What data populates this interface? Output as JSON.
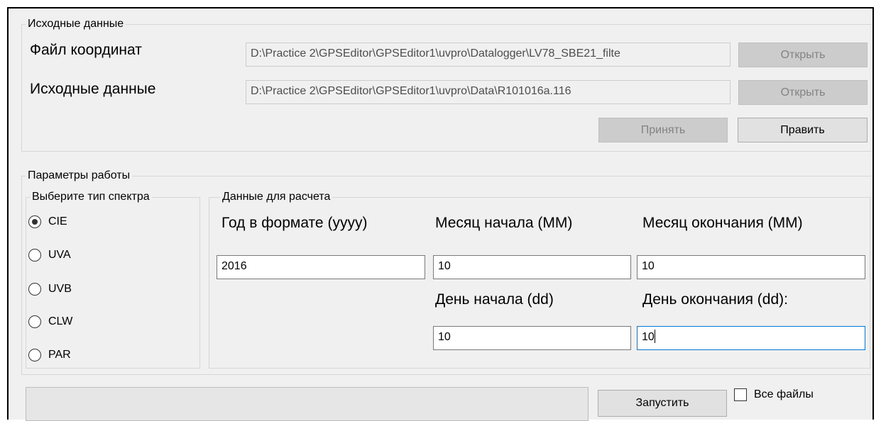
{
  "source_group": {
    "legend": "Исходные данные",
    "coords_label": "Файл координат",
    "coords_path": "D:\\Practice 2\\GPSEditor\\GPSEditor1\\uvpro\\Datalogger\\LV78_SBE21_filte",
    "coords_open_label": "Открыть",
    "data_label": "Исходные данные",
    "data_path": "D:\\Practice 2\\GPSEditor\\GPSEditor1\\uvpro\\Data\\R101016a.116",
    "data_open_label": "Открыть",
    "accept_label": "Принять",
    "edit_label": "Править"
  },
  "params_group": {
    "legend": "Параметры работы",
    "spectrum_group": {
      "legend": "Выберите тип спектра",
      "options": [
        {
          "label": "CIE",
          "checked": true
        },
        {
          "label": "UVA",
          "checked": false
        },
        {
          "label": "UVB",
          "checked": false
        },
        {
          "label": "CLW",
          "checked": false
        },
        {
          "label": "PAR",
          "checked": false
        }
      ]
    },
    "calc_group": {
      "legend": "Данные для расчета",
      "year_label": "Год в формате (yyyy)",
      "year_value": "2016",
      "start_month_label": "Месяц начала (MM)",
      "start_month_value": "10",
      "end_month_label": "Месяц окончания (MM)",
      "end_month_value": "10",
      "start_day_label": "День начала (dd)",
      "start_day_value": "10",
      "end_day_label": "День окончания (dd):",
      "end_day_value": "10"
    }
  },
  "footer": {
    "run_label": "Запустить",
    "all_files_label": "Все файлы",
    "all_files_checked": false
  }
}
